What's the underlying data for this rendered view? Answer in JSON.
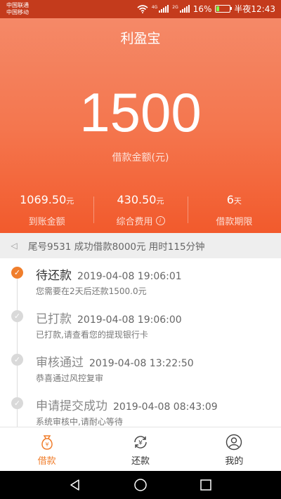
{
  "status_bar": {
    "carrier_1": "中国联通",
    "carrier_2": "中国移动",
    "net_1": "4G",
    "net_2": "2G",
    "battery": "16%",
    "time": "半夜12:43"
  },
  "header": {
    "title": "利盈宝",
    "amount": "1500",
    "amount_label": "借款金额(元)"
  },
  "stats": [
    {
      "value": "1069.50",
      "unit": "元",
      "label": "到账金额"
    },
    {
      "value": "430.50",
      "unit": "元",
      "label": "综合费用"
    },
    {
      "value": "6",
      "unit": "天",
      "label": "借款期限"
    }
  ],
  "notice": {
    "text": "尾号9531 成功借款8000元 用时115分钟"
  },
  "timeline": [
    {
      "title": "待还款",
      "time": "2019-04-08 19:06:01",
      "desc": "您需要在2天后还款1500.0元",
      "active": true
    },
    {
      "title": "已打款",
      "time": "2019-04-08 19:06:00",
      "desc": "已打款,请查看您的提现银行卡",
      "active": false
    },
    {
      "title": "审核通过",
      "time": "2019-04-08 13:22:50",
      "desc": "恭喜通过风控复审",
      "active": false
    },
    {
      "title": "申请提交成功",
      "time": "2019-04-08 08:43:09",
      "desc": "系统审核中,请耐心等待",
      "active": false
    }
  ],
  "tabs": [
    {
      "label": "借款",
      "icon": "loan-bag-icon",
      "active": true
    },
    {
      "label": "还款",
      "icon": "repay-cycle-icon",
      "active": false
    },
    {
      "label": "我的",
      "icon": "user-profile-icon",
      "active": false
    }
  ],
  "colors": {
    "accent": "#f07e2c",
    "header_top": "#f58c6c",
    "header_bottom": "#f25a2c",
    "status_bar": "#c43b1c"
  },
  "icons": {
    "wifi": "wifi-icon",
    "signal": "signal-icon",
    "battery": "battery-icon",
    "notice": "speaker-icon",
    "back": "nav-back-icon",
    "home": "nav-home-icon",
    "recents": "nav-recents-icon"
  }
}
